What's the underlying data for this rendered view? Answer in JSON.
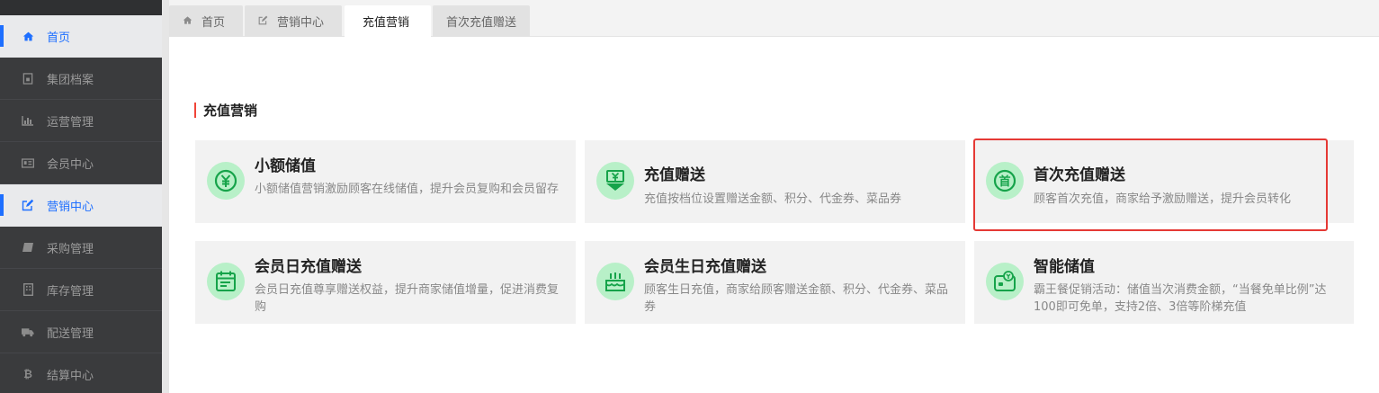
{
  "sidebar": {
    "items": [
      {
        "label": "首页",
        "icon": "home-icon",
        "active": true
      },
      {
        "label": "集团档案",
        "icon": "file-icon",
        "active": false
      },
      {
        "label": "运营管理",
        "icon": "bar-chart-icon",
        "active": false
      },
      {
        "label": "会员中心",
        "icon": "id-card-icon",
        "active": false
      },
      {
        "label": "营销中心",
        "icon": "edit-icon",
        "active": true
      },
      {
        "label": "采购管理",
        "icon": "book-icon",
        "active": false
      },
      {
        "label": "库存管理",
        "icon": "building-icon",
        "active": false
      },
      {
        "label": "配送管理",
        "icon": "truck-icon",
        "active": false
      },
      {
        "label": "结算中心",
        "icon": "bitcoin-icon",
        "active": false
      }
    ]
  },
  "tabs": [
    {
      "label": "首页",
      "icon": "home-icon"
    },
    {
      "label": "营销中心",
      "icon": "edit-icon"
    },
    {
      "label": "充值营销"
    },
    {
      "label": "首次充值赠送"
    }
  ],
  "section": {
    "title": "充值营销"
  },
  "cards": [
    {
      "title": "小额储值",
      "desc": "小额储值营销激励顾客在线储值，提升会员复购和会员留存",
      "icon": "yuan-circle-icon"
    },
    {
      "title": "充值赠送",
      "desc": "充值按档位设置赠送金额、积分、代金券、菜品券",
      "icon": "yuan-gift-icon"
    },
    {
      "title": "首次充值赠送",
      "desc": "顾客首次充值，商家给予激励赠送，提升会员转化",
      "icon": "first-circle-icon"
    },
    {
      "title": "会员日充值赠送",
      "desc": "会员日充值尊享赠送权益，提升商家储值增量，促进消费复购",
      "icon": "calendar-icon"
    },
    {
      "title": "会员生日充值赠送",
      "desc": "顾客生日充值，商家给顾客赠送金额、积分、代金券、菜品券",
      "icon": "cake-icon"
    },
    {
      "title": "智能储值",
      "desc": "霸王餐促销活动：储值当次消费金额，“当餐免单比例”达100即可免单，支持2倍、3倍等阶梯充值",
      "icon": "smart-wallet-icon"
    }
  ],
  "colors": {
    "accent": "#1e6fff",
    "highlight": "#e53935",
    "icon_green": "#22c55e",
    "icon_bg": "#b8f0c8"
  }
}
